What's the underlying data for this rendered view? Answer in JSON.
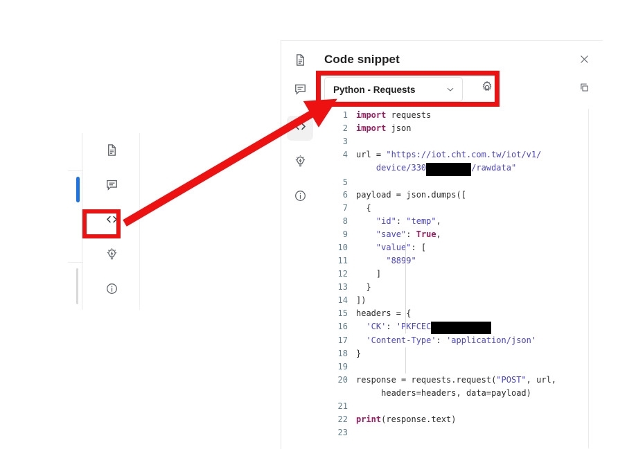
{
  "panel": {
    "title": "Code snippet",
    "close_icon": "close-icon",
    "copy_icon": "copy-icon",
    "document_icon": "document-icon",
    "comment_icon": "comment-icon",
    "code_icon": "code-icon",
    "lightbulb_icon": "lightbulb-icon",
    "info_icon": "info-icon",
    "rail_items": [
      {
        "icon": "document-icon",
        "name": "panel-rail-document",
        "active": false
      },
      {
        "icon": "comment-icon",
        "name": "panel-rail-comment",
        "active": false
      },
      {
        "icon": "code-icon",
        "name": "panel-rail-code",
        "active": true
      },
      {
        "icon": "lightbulb-icon",
        "name": "panel-rail-lightbulb",
        "active": false
      },
      {
        "icon": "info-icon",
        "name": "panel-rail-info",
        "active": false
      }
    ]
  },
  "language_select": {
    "value": "Python - Requests",
    "chevron_icon": "chevron-down-icon",
    "settings_icon": "gear-icon"
  },
  "left_rail": {
    "items": [
      {
        "icon": "document-icon",
        "name": "left-rail-document"
      },
      {
        "icon": "comment-icon",
        "name": "left-rail-comment"
      },
      {
        "icon": "code-icon",
        "name": "left-rail-code"
      },
      {
        "icon": "lightbulb-icon",
        "name": "left-rail-lightbulb"
      },
      {
        "icon": "info-icon",
        "name": "left-rail-info"
      }
    ]
  },
  "annotation": {
    "color": "#ee1111",
    "shapes": [
      "rect-around-language-dropdown",
      "rect-around-code-icon",
      "arrow-from-code-icon-to-dropdown"
    ]
  },
  "code": {
    "language": "python",
    "first_line": 1,
    "last_line": 23,
    "lines": [
      {
        "n": 1,
        "tokens": [
          {
            "t": "kw",
            "v": "import"
          },
          {
            "t": "plain",
            "v": " requests"
          }
        ]
      },
      {
        "n": 2,
        "tokens": [
          {
            "t": "kw",
            "v": "import"
          },
          {
            "t": "plain",
            "v": " json"
          }
        ]
      },
      {
        "n": 3,
        "tokens": []
      },
      {
        "n": 4,
        "tokens": [
          {
            "t": "plain",
            "v": "url = "
          },
          {
            "t": "str",
            "v": "\"https://iot.cht.com.tw/iot/v1/"
          }
        ]
      },
      {
        "n": null,
        "tokens": [
          {
            "t": "plain",
            "v": "    "
          },
          {
            "t": "str",
            "v": "device/330"
          },
          {
            "t": "redact",
            "v": "XXXXXXXXX"
          },
          {
            "t": "str",
            "v": "/rawdata\""
          }
        ]
      },
      {
        "n": 5,
        "tokens": []
      },
      {
        "n": 6,
        "tokens": [
          {
            "t": "plain",
            "v": "payload = json.dumps(["
          }
        ]
      },
      {
        "n": 7,
        "tokens": [
          {
            "t": "plain",
            "v": "  {"
          }
        ]
      },
      {
        "n": 8,
        "tokens": [
          {
            "t": "plain",
            "v": "    "
          },
          {
            "t": "str",
            "v": "\"id\""
          },
          {
            "t": "plain",
            "v": ": "
          },
          {
            "t": "str",
            "v": "\"temp\""
          },
          {
            "t": "plain",
            "v": ","
          }
        ]
      },
      {
        "n": 9,
        "tokens": [
          {
            "t": "plain",
            "v": "    "
          },
          {
            "t": "str",
            "v": "\"save\""
          },
          {
            "t": "plain",
            "v": ": "
          },
          {
            "t": "kw",
            "v": "True"
          },
          {
            "t": "plain",
            "v": ","
          }
        ]
      },
      {
        "n": 10,
        "tokens": [
          {
            "t": "plain",
            "v": "    "
          },
          {
            "t": "str",
            "v": "\"value\""
          },
          {
            "t": "plain",
            "v": ": ["
          }
        ]
      },
      {
        "n": 11,
        "tokens": [
          {
            "t": "plain",
            "v": "      "
          },
          {
            "t": "str",
            "v": "\"8899\""
          }
        ]
      },
      {
        "n": 12,
        "tokens": [
          {
            "t": "plain",
            "v": "    ]"
          }
        ]
      },
      {
        "n": 13,
        "tokens": [
          {
            "t": "plain",
            "v": "  }"
          }
        ]
      },
      {
        "n": 14,
        "tokens": [
          {
            "t": "plain",
            "v": "])"
          }
        ]
      },
      {
        "n": 15,
        "tokens": [
          {
            "t": "plain",
            "v": "headers = {"
          }
        ]
      },
      {
        "n": 16,
        "tokens": [
          {
            "t": "plain",
            "v": "  "
          },
          {
            "t": "str",
            "v": "'CK'"
          },
          {
            "t": "plain",
            "v": ": "
          },
          {
            "t": "str",
            "v": "'PKFCEC"
          },
          {
            "t": "redact",
            "v": "XXXXXXXXXXXX"
          }
        ]
      },
      {
        "n": 17,
        "tokens": [
          {
            "t": "plain",
            "v": "  "
          },
          {
            "t": "str",
            "v": "'Content-Type'"
          },
          {
            "t": "plain",
            "v": ": "
          },
          {
            "t": "str",
            "v": "'application/json'"
          }
        ]
      },
      {
        "n": 18,
        "tokens": [
          {
            "t": "plain",
            "v": "}"
          }
        ]
      },
      {
        "n": 19,
        "tokens": []
      },
      {
        "n": 20,
        "tokens": [
          {
            "t": "plain",
            "v": "response = requests.request("
          },
          {
            "t": "str",
            "v": "\"POST\""
          },
          {
            "t": "plain",
            "v": ", url,"
          }
        ]
      },
      {
        "n": null,
        "tokens": [
          {
            "t": "plain",
            "v": "     headers=headers, data=payload)"
          }
        ]
      },
      {
        "n": 21,
        "tokens": []
      },
      {
        "n": 22,
        "tokens": [
          {
            "t": "kw",
            "v": "print"
          },
          {
            "t": "plain",
            "v": "(response.text)"
          }
        ]
      },
      {
        "n": 23,
        "tokens": []
      }
    ]
  }
}
